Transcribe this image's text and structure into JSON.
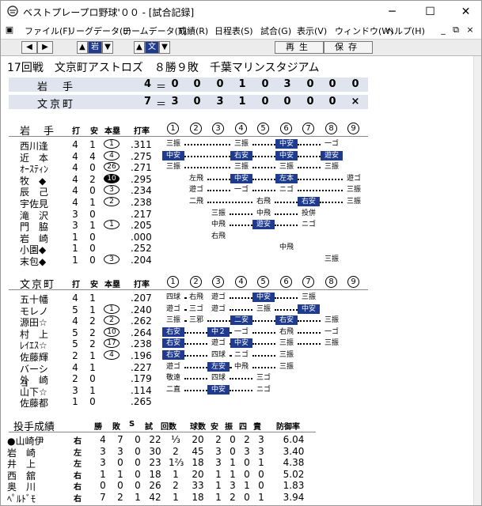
{
  "window": {
    "title": "ベストプレープロ野球'００ - [試合記録]"
  },
  "menu": [
    "ファイル(F)",
    "リーグデータ(L)",
    "チームデータ(T)",
    "成績(R)",
    "日程表(S)",
    "試合(G)",
    "表示(V)",
    "ウィンドウ(W)",
    "ヘルプ(H)"
  ],
  "toolbar": {
    "team_left": "岩",
    "team_right": "文",
    "play": "再生",
    "save": "保存"
  },
  "header": "17回戦　文京町アストロズ　８勝９敗　千葉マリンスタジアム",
  "scoreboard": [
    {
      "team": "岩　手",
      "runs": "4",
      "eq": "＝",
      "innings": [
        "0",
        "0",
        "0",
        "1",
        "0",
        "3",
        "0",
        "0",
        "0"
      ]
    },
    {
      "team": "文京町",
      "runs": "7",
      "eq": "＝",
      "innings": [
        "3",
        "0",
        "3",
        "1",
        "0",
        "0",
        "0",
        "0",
        "×"
      ]
    }
  ],
  "batting_headers": {
    "at": "打",
    "hit": "安",
    "hr": "本塁",
    "avg": "打率"
  },
  "inning_labels": [
    "1",
    "2",
    "3",
    "4",
    "5",
    "6",
    "7",
    "8",
    "9"
  ],
  "away": {
    "team": "岩　手",
    "batters": [
      {
        "name": "西川逢",
        "ab": "4",
        "h": "1",
        "hr": "1",
        "hr_fill": false,
        "avg": ".311",
        "cells": [
          [
            "三振",
            0
          ],
          [
            "",
            0
          ],
          [
            "",
            0
          ],
          [
            "三振",
            0
          ],
          [
            "",
            0
          ],
          [
            "中安",
            1
          ],
          [
            "",
            0
          ],
          [
            "一ゴ",
            0
          ],
          [
            "",
            0
          ]
        ]
      },
      {
        "name": "近　本",
        "ab": "4",
        "h": "4",
        "hr": "4",
        "hr_fill": false,
        "avg": ".275",
        "cells": [
          [
            "中安",
            1
          ],
          [
            "",
            0
          ],
          [
            "",
            0
          ],
          [
            "右安",
            1
          ],
          [
            "",
            0
          ],
          [
            "中安",
            1
          ],
          [
            "",
            0
          ],
          [
            "遊安",
            1
          ],
          [
            "",
            0
          ]
        ]
      },
      {
        "name": "ｵｰｽﾃｨﾝ",
        "ab": "4",
        "h": "0",
        "hr": "26",
        "hr_fill": false,
        "avg": ".271",
        "cells": [
          [
            "三振",
            0
          ],
          [
            "",
            0
          ],
          [
            "",
            0
          ],
          [
            "三振",
            0
          ],
          [
            "",
            0
          ],
          [
            "三振",
            0
          ],
          [
            "",
            0
          ],
          [
            "三振",
            0
          ],
          [
            "",
            0
          ]
        ]
      },
      {
        "name": "牧　◆",
        "ab": "4",
        "h": "2",
        "hr": "10",
        "hr_fill": true,
        "avg": ".295",
        "cells": [
          [
            "",
            0
          ],
          [
            "左飛",
            0
          ],
          [
            "",
            0
          ],
          [
            "中安",
            1
          ],
          [
            "",
            0
          ],
          [
            "左本",
            1
          ],
          [
            "",
            0
          ],
          [
            "",
            0
          ],
          [
            "遊ゴ",
            0
          ]
        ]
      },
      {
        "name": "辰　己",
        "ab": "4",
        "h": "0",
        "hr": "3",
        "hr_fill": false,
        "avg": ".234",
        "cells": [
          [
            "",
            0
          ],
          [
            "遊ゴ",
            0
          ],
          [
            "",
            0
          ],
          [
            "一ゴ",
            0
          ],
          [
            "",
            0
          ],
          [
            "ニゴ",
            0
          ],
          [
            "",
            0
          ],
          [
            "",
            0
          ],
          [
            "三振",
            0
          ]
        ]
      },
      {
        "name": "宇佐見",
        "ab": "4",
        "h": "1",
        "hr": "2",
        "hr_fill": false,
        "avg": ".238",
        "cells": [
          [
            "",
            0
          ],
          [
            "二飛",
            0
          ],
          [
            "",
            0
          ],
          [
            "",
            0
          ],
          [
            "右飛",
            0
          ],
          [
            "",
            0
          ],
          [
            "右安",
            1
          ],
          [
            "",
            0
          ],
          [
            "三振",
            0
          ]
        ]
      },
      {
        "name": "滝　沢",
        "ab": "3",
        "h": "0",
        "hr": "",
        "hr_fill": false,
        "avg": ".217",
        "cells": [
          [
            "",
            0
          ],
          [
            "",
            0
          ],
          [
            "三振",
            0
          ],
          [
            "",
            0
          ],
          [
            "中飛",
            0
          ],
          [
            "",
            0
          ],
          [
            "投併",
            0
          ],
          [
            "",
            0
          ],
          [
            "",
            0
          ]
        ]
      },
      {
        "name": "門　脇",
        "ab": "3",
        "h": "1",
        "hr": "1",
        "hr_fill": false,
        "avg": ".205",
        "cells": [
          [
            "",
            0
          ],
          [
            "",
            0
          ],
          [
            "中飛",
            0
          ],
          [
            "",
            0
          ],
          [
            "遊安",
            1
          ],
          [
            "",
            0
          ],
          [
            "ニゴ",
            0
          ],
          [
            "",
            0
          ],
          [
            "",
            0
          ]
        ]
      },
      {
        "name": "岩　崎",
        "ab": "1",
        "h": "0",
        "hr": "",
        "hr_fill": false,
        "avg": ".000",
        "cells": [
          [
            "",
            0
          ],
          [
            "",
            0
          ],
          [
            "右飛",
            0
          ],
          [
            "",
            0
          ],
          [
            "",
            0
          ],
          [
            "",
            0
          ],
          [
            "",
            0
          ],
          [
            "",
            0
          ],
          [
            "",
            0
          ]
        ]
      },
      {
        "name": "小園◆",
        "ab": "1",
        "h": "0",
        "hr": "",
        "hr_fill": false,
        "avg": ".252",
        "cells": [
          [
            "",
            0
          ],
          [
            "",
            0
          ],
          [
            "",
            0
          ],
          [
            "",
            0
          ],
          [
            "",
            0
          ],
          [
            "中飛",
            0
          ],
          [
            "",
            0
          ],
          [
            "",
            0
          ],
          [
            "",
            0
          ]
        ]
      },
      {
        "name": "末包◆",
        "ab": "1",
        "h": "0",
        "hr": "3",
        "hr_fill": false,
        "avg": ".204",
        "cells": [
          [
            "",
            0
          ],
          [
            "",
            0
          ],
          [
            "",
            0
          ],
          [
            "",
            0
          ],
          [
            "",
            0
          ],
          [
            "",
            0
          ],
          [
            "",
            0
          ],
          [
            "三振",
            0
          ],
          [
            "",
            0
          ]
        ]
      }
    ]
  },
  "home": {
    "team": "文京町",
    "batters": [
      {
        "name": "五十幡",
        "ab": "4",
        "h": "1",
        "hr": "",
        "hr_fill": false,
        "avg": ".207",
        "cells": [
          [
            "四球",
            0
          ],
          [
            "右飛",
            0
          ],
          [
            "遊ゴ",
            0
          ],
          [
            "",
            0
          ],
          [
            "中安",
            1
          ],
          [
            "",
            0
          ],
          [
            "三振",
            0
          ],
          [
            "",
            0
          ],
          [
            "",
            0
          ]
        ]
      },
      {
        "name": "モレノ",
        "ab": "5",
        "h": "1",
        "hr": "1",
        "hr_fill": false,
        "avg": ".240",
        "cells": [
          [
            "遊ゴ",
            0
          ],
          [
            "三ゴ",
            0
          ],
          [
            "遊ゴ",
            0
          ],
          [
            "",
            0
          ],
          [
            "三振",
            0
          ],
          [
            "",
            0
          ],
          [
            "中安",
            1
          ],
          [
            "",
            0
          ],
          [
            "",
            0
          ]
        ]
      },
      {
        "name": "源田☆",
        "ab": "4",
        "h": "2",
        "hr": "2",
        "hr_fill": false,
        "avg": ".262",
        "cells": [
          [
            "三振",
            0
          ],
          [
            "三邪",
            0
          ],
          [
            "",
            0
          ],
          [
            "二安",
            1
          ],
          [
            "",
            0
          ],
          [
            "右安",
            1
          ],
          [
            "",
            0
          ],
          [
            "三振",
            0
          ],
          [
            "",
            0
          ]
        ]
      },
      {
        "name": "村　上",
        "ab": "5",
        "h": "2",
        "hr": "10",
        "hr_fill": false,
        "avg": ".264",
        "cells": [
          [
            "右安",
            1
          ],
          [
            "",
            0
          ],
          [
            "中２",
            1
          ],
          [
            "一ゴ",
            0
          ],
          [
            "",
            0
          ],
          [
            "右飛",
            0
          ],
          [
            "",
            0
          ],
          [
            "一ゴ",
            0
          ],
          [
            "",
            0
          ]
        ]
      },
      {
        "name": "ﾚｲｴｽ☆",
        "ab": "5",
        "h": "2",
        "hr": "17",
        "hr_fill": false,
        "avg": ".238",
        "cells": [
          [
            "右安",
            1
          ],
          [
            "",
            0
          ],
          [
            "遊ゴ",
            0
          ],
          [
            "中安",
            1
          ],
          [
            "",
            0
          ],
          [
            "三振",
            0
          ],
          [
            "",
            0
          ],
          [
            "三振",
            0
          ],
          [
            "",
            0
          ]
        ]
      },
      {
        "name": "佐藤輝",
        "ab": "2",
        "h": "1",
        "hr": "4",
        "hr_fill": false,
        "avg": ".196",
        "cells": [
          [
            "右安",
            1
          ],
          [
            "",
            0
          ],
          [
            "四球",
            0
          ],
          [
            "ニゴ",
            0
          ],
          [
            "",
            0
          ],
          [
            "三振",
            0
          ],
          [
            "",
            0
          ],
          [
            "",
            0
          ],
          [
            "",
            0
          ]
        ]
      },
      {
        "name": "バーショ",
        "ab": "4",
        "h": "1",
        "hr": "",
        "hr_fill": false,
        "avg": ".227",
        "cells": [
          [
            "遊ゴ",
            0
          ],
          [
            "",
            0
          ],
          [
            "左安",
            1
          ],
          [
            "中飛",
            0
          ],
          [
            "",
            0
          ],
          [
            "三振",
            0
          ],
          [
            "",
            0
          ],
          [
            "",
            0
          ],
          [
            "",
            0
          ]
        ]
      },
      {
        "name": "外　崎",
        "ab": "2",
        "h": "0",
        "hr": "",
        "hr_fill": false,
        "avg": ".179",
        "cells": [
          [
            "敬遠",
            0
          ],
          [
            "",
            0
          ],
          [
            "四球",
            0
          ],
          [
            "",
            0
          ],
          [
            "三ゴ",
            0
          ],
          [
            "",
            0
          ],
          [
            "",
            0
          ],
          [
            "",
            0
          ],
          [
            "",
            0
          ]
        ]
      },
      {
        "name": "山下☆",
        "ab": "3",
        "h": "1",
        "hr": "",
        "hr_fill": false,
        "avg": ".114",
        "cells": [
          [
            "二直",
            0
          ],
          [
            "",
            0
          ],
          [
            "中安",
            1
          ],
          [
            "",
            0
          ],
          [
            "ニゴ",
            0
          ],
          [
            "",
            0
          ],
          [
            "",
            0
          ],
          [
            "",
            0
          ],
          [
            "",
            0
          ]
        ]
      },
      {
        "name": "佐藤都",
        "ab": "1",
        "h": "0",
        "hr": "",
        "hr_fill": false,
        "avg": ".265",
        "cells": [
          [
            "",
            0
          ],
          [
            "",
            0
          ],
          [
            "",
            0
          ],
          [
            "",
            0
          ],
          [
            "",
            0
          ],
          [
            "",
            0
          ],
          [
            "",
            0
          ],
          [
            "",
            0
          ],
          [
            "",
            0
          ]
        ]
      }
    ]
  },
  "pitching": {
    "title": "投手成績",
    "headers": [
      "勝",
      "敗",
      "S",
      "試",
      "回数",
      "球数",
      "安",
      "振",
      "四",
      "責",
      "防御率"
    ],
    "rows": [
      {
        "name": "●山崎伊",
        "hand": "右",
        "w": "4",
        "l": "7",
        "s": "0",
        "g": "22",
        "ip": "⅓",
        "pc": "20",
        "h": "2",
        "k": "0",
        "bb": "2",
        "er": "3",
        "era": "6.04"
      },
      {
        "name": "岩　崎",
        "hand": "左",
        "w": "3",
        "l": "3",
        "s": "0",
        "g": "30",
        "ip": "2",
        "pc": "45",
        "h": "3",
        "k": "0",
        "bb": "3",
        "er": "3",
        "era": "3.40"
      },
      {
        "name": "井　上",
        "hand": "左",
        "w": "3",
        "l": "0",
        "s": "0",
        "g": "23",
        "ip": "1⅔",
        "pc": "18",
        "h": "3",
        "k": "1",
        "bb": "0",
        "er": "1",
        "era": "4.38"
      },
      {
        "name": "西　舘",
        "hand": "右",
        "w": "1",
        "l": "1",
        "s": "0",
        "g": "18",
        "ip": "1",
        "pc": "20",
        "h": "1",
        "k": "1",
        "bb": "0",
        "er": "0",
        "era": "5.02"
      },
      {
        "name": "奥　川",
        "hand": "右",
        "w": "0",
        "l": "0",
        "s": "0",
        "g": "26",
        "ip": "2",
        "pc": "33",
        "h": "1",
        "k": "3",
        "bb": "1",
        "er": "0",
        "era": "1.83"
      },
      {
        "name": "ﾍﾟﾙﾄﾞﾓ",
        "hand": "右",
        "w": "7",
        "l": "2",
        "s": "1",
        "g": "42",
        "ip": "1",
        "pc": "18",
        "h": "1",
        "k": "2",
        "bb": "0",
        "er": "1",
        "era": "3.94"
      }
    ]
  },
  "icons": {
    "app": "app-icon",
    "nav": [
      "arrow-left-icon",
      "arrow-right-icon",
      "arrow-up-icon",
      "arrow-down-icon"
    ]
  }
}
